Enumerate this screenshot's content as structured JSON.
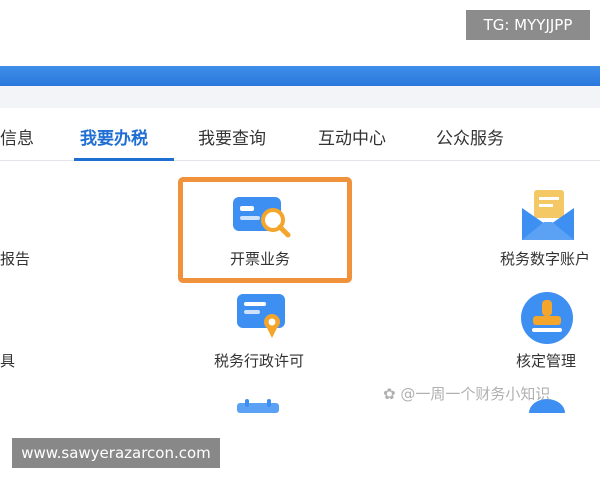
{
  "overlay": {
    "tg_text": "TG: MYYJJPP",
    "url_text": "www.sawyerazarcon.com",
    "watermark_text": "一周一个财务小知识"
  },
  "nav": {
    "tabs": [
      {
        "label": "信息"
      },
      {
        "label": "我要办税",
        "active": true
      },
      {
        "label": "我要查询"
      },
      {
        "label": "互动中心"
      },
      {
        "label": "公众服务"
      }
    ]
  },
  "grid": {
    "left_partial_1": "报告",
    "left_partial_2": "具",
    "invoice": "开票业务",
    "license": "税务行政许可",
    "digital_account": "税务数字账户",
    "verification": "核定管理"
  },
  "colors": {
    "accent_blue": "#1f6fd3",
    "highlight_orange": "#f0923c",
    "icon_blue": "#3d8ff2",
    "icon_gold": "#f4a52b"
  },
  "icons": [
    "invoice-search-icon",
    "license-certificate-icon",
    "envelope-document-icon",
    "stamp-icon",
    "calendar-icon"
  ]
}
